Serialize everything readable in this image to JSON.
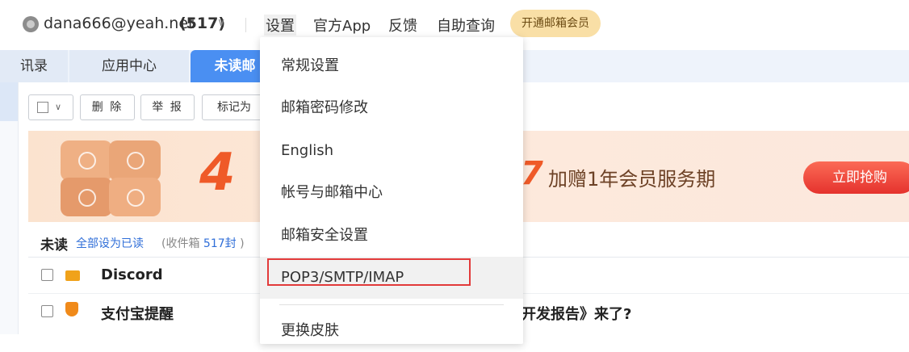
{
  "topbar": {
    "email": "dana666@yeah.net",
    "count": "(517)",
    "nav": {
      "settings": "设置",
      "app": "官方App",
      "feedback": "反馈",
      "help": "自助查询"
    },
    "vip": "开通邮箱会员"
  },
  "tabs": {
    "contacts": "讯录",
    "apps": "应用中心",
    "unread": "未读邮"
  },
  "toolbar": {
    "delete": "删 除",
    "report": "举 报",
    "mark": "标记为"
  },
  "banner": {
    "num": "4",
    "tail": "7",
    "text": "加赠1年会员服务期",
    "button": "立即抢购"
  },
  "list": {
    "title": "未读",
    "mark_all": "全部设为已读",
    "count_prefix": "(收件箱",
    "count_value": "517封",
    "count_suffix": ")",
    "rows": [
      {
        "sender": "Discord",
        "subject": ""
      },
      {
        "sender": "支付宝提醒",
        "subject": "度开发报告》来了?"
      }
    ]
  },
  "dropdown": {
    "items": [
      "常规设置",
      "邮箱密码修改",
      "English",
      "帐号与邮箱中心",
      "邮箱安全设置",
      "POP3/SMTP/IMAP",
      "更换皮肤"
    ]
  }
}
